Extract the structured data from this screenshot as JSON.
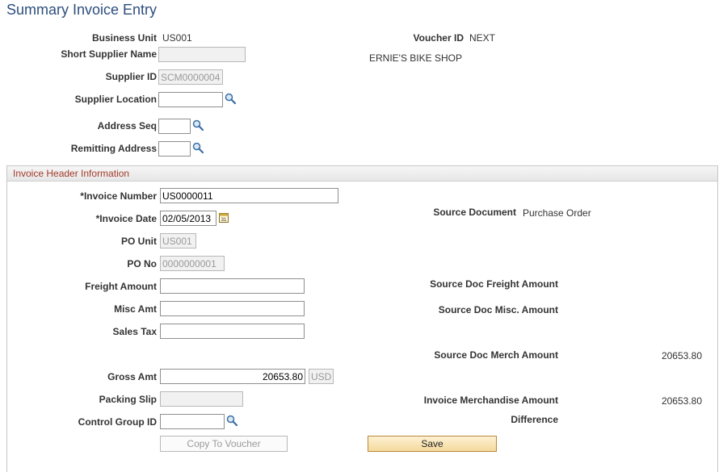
{
  "page": {
    "title": "Summary Invoice Entry"
  },
  "header": {
    "business_unit_label": "Business Unit",
    "business_unit": "US001",
    "voucher_id_label": "Voucher ID",
    "voucher_id": "NEXT",
    "short_supplier_name_label": "Short Supplier Name",
    "short_supplier_name": "",
    "supplier_name": "ERNIE'S BIKE SHOP",
    "supplier_id_label": "Supplier ID",
    "supplier_id": "SCM0000004",
    "supplier_location_label": "Supplier Location",
    "supplier_location": "",
    "address_seq_label": "Address Seq",
    "address_seq": "",
    "remitting_address_label": "Remitting Address",
    "remitting_address": ""
  },
  "invoice_header": {
    "section_title": "Invoice Header Information",
    "invoice_number_label": "*Invoice Number",
    "invoice_number": "US0000011",
    "invoice_date_label": "*Invoice Date",
    "invoice_date": "02/05/2013",
    "source_document_label": "Source Document",
    "source_document": "Purchase Order",
    "po_unit_label": "PO Unit",
    "po_unit": "US001",
    "po_no_label": "PO No",
    "po_no": "0000000001",
    "freight_amount_label": "Freight Amount",
    "freight_amount": "",
    "source_doc_freight_label": "Source Doc Freight Amount",
    "misc_amt_label": "Misc Amt",
    "misc_amt": "",
    "source_doc_misc_label": "Source Doc Misc. Amount",
    "sales_tax_label": "Sales Tax",
    "sales_tax": "",
    "source_doc_merch_label": "Source Doc Merch Amount",
    "source_doc_merch_amount": "20653.80",
    "gross_amt_label": "Gross Amt",
    "gross_amt": "20653.80",
    "currency": "USD",
    "packing_slip_label": "Packing Slip",
    "packing_slip": "",
    "invoice_merch_label": "Invoice Merchandise Amount",
    "invoice_merch_amount": "20653.80",
    "control_group_label": "Control Group ID",
    "control_group": "",
    "difference_label": "Difference"
  },
  "actions": {
    "copy_to_voucher": "Copy To Voucher",
    "save": "Save"
  },
  "icons": {
    "lookup": "magnifier-icon",
    "calendar": "calendar-icon"
  }
}
